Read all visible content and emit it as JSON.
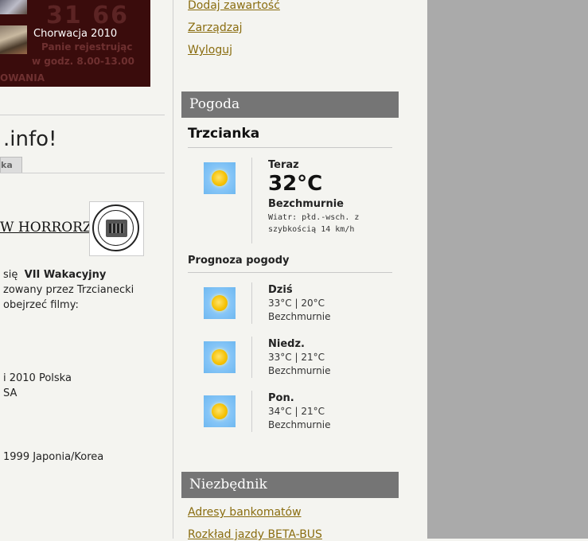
{
  "banner": {
    "big_text": "31 66",
    "line1": "Panie rejestrując",
    "line2": "w godz. 8.00-13.00",
    "line3": "OWANIA",
    "caption": "Chorwacja 2010"
  },
  "left": {
    "site_title": ".info!",
    "tab_label": "ka",
    "article_title": "W HORRORZE",
    "body_lines": [
      "się  VII Wakacyjny",
      "zowany przez Trzcianecki",
      "obejrzeć filmy:",
      "i 2010 Polska",
      "SA",
      "1999 Japonia/Korea"
    ]
  },
  "user_menu": [
    "Dodaj zawartość",
    "Zarządzaj",
    "Wyloguj"
  ],
  "weather": {
    "header": "Pogoda",
    "city": "Trzcianka",
    "now_label": "Teraz",
    "now_temp": "32°C",
    "now_condition": "Bezchmurnie",
    "now_wind": "Wiatr: płd.-wsch. z szybkością 14 km/h",
    "forecast_title": "Prognoza pogody",
    "forecast": [
      {
        "day": "Dziś",
        "temps": "33°C | 20°C",
        "condition": "Bezchmurnie"
      },
      {
        "day": "Niedz.",
        "temps": "33°C | 21°C",
        "condition": "Bezchmurnie"
      },
      {
        "day": "Pon.",
        "temps": "34°C | 21°C",
        "condition": "Bezchmurnie"
      }
    ]
  },
  "niezbednik": {
    "header": "Niezbędnik",
    "links": [
      "Adresy bankomatów",
      "Rozkład jazdy BETA-BUS"
    ]
  },
  "colors": {
    "link": "#8a6d10",
    "panel_header": "#757575",
    "right_gutter": "#aaaaaa"
  }
}
